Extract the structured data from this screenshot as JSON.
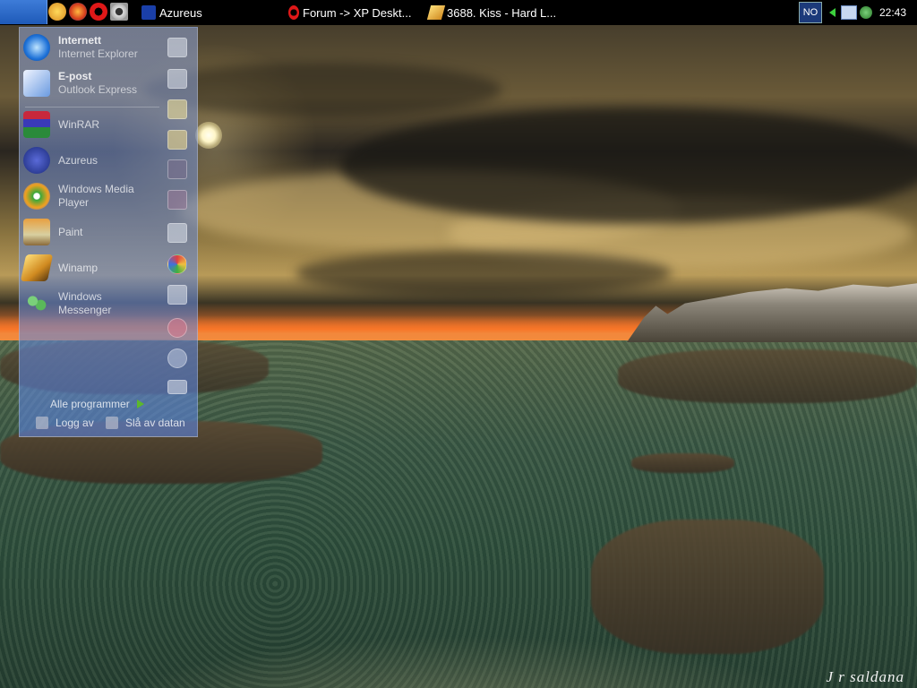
{
  "taskbar": {
    "tasks": [
      {
        "label": "Azureus",
        "icon": "azureus-icon"
      },
      {
        "label": "Forum -> XP Deskt...",
        "icon": "opera-icon"
      },
      {
        "label": "3688. Kiss - Hard L...",
        "icon": "winamp-icon"
      }
    ],
    "quicklaunch": [
      "winamp-icon",
      "firefox-icon",
      "opera-icon",
      "camera-icon"
    ],
    "tray": {
      "box_label": "NO",
      "clock": "22:43"
    }
  },
  "start_menu": {
    "pinned": [
      {
        "title": "Internett",
        "subtitle": "Internet Explorer",
        "icon": "internet-explorer-icon"
      },
      {
        "title": "E-post",
        "subtitle": "Outlook Express",
        "icon": "outlook-express-icon"
      }
    ],
    "programs": [
      {
        "label": "WinRAR",
        "icon": "winrar-icon"
      },
      {
        "label": "Azureus",
        "icon": "azureus-icon"
      },
      {
        "label": "Windows Media Player",
        "icon": "media-player-icon"
      },
      {
        "label": "Paint",
        "icon": "paint-icon"
      },
      {
        "label": "Winamp",
        "icon": "winamp-icon"
      },
      {
        "label": "Windows Messenger",
        "icon": "messenger-icon"
      }
    ],
    "places": [
      "documents-icon",
      "recent-documents-icon",
      "pictures-icon",
      "folder-icon",
      "my-computer-icon",
      "network-icon",
      "control-panel-icon",
      "printers-icon",
      "help-icon",
      "search-icon",
      "run-icon"
    ],
    "all_programs": "Alle programmer",
    "logoff": "Logg av",
    "shutdown": "Slå av datan"
  },
  "desktop": {
    "signature": "J r saldana"
  }
}
